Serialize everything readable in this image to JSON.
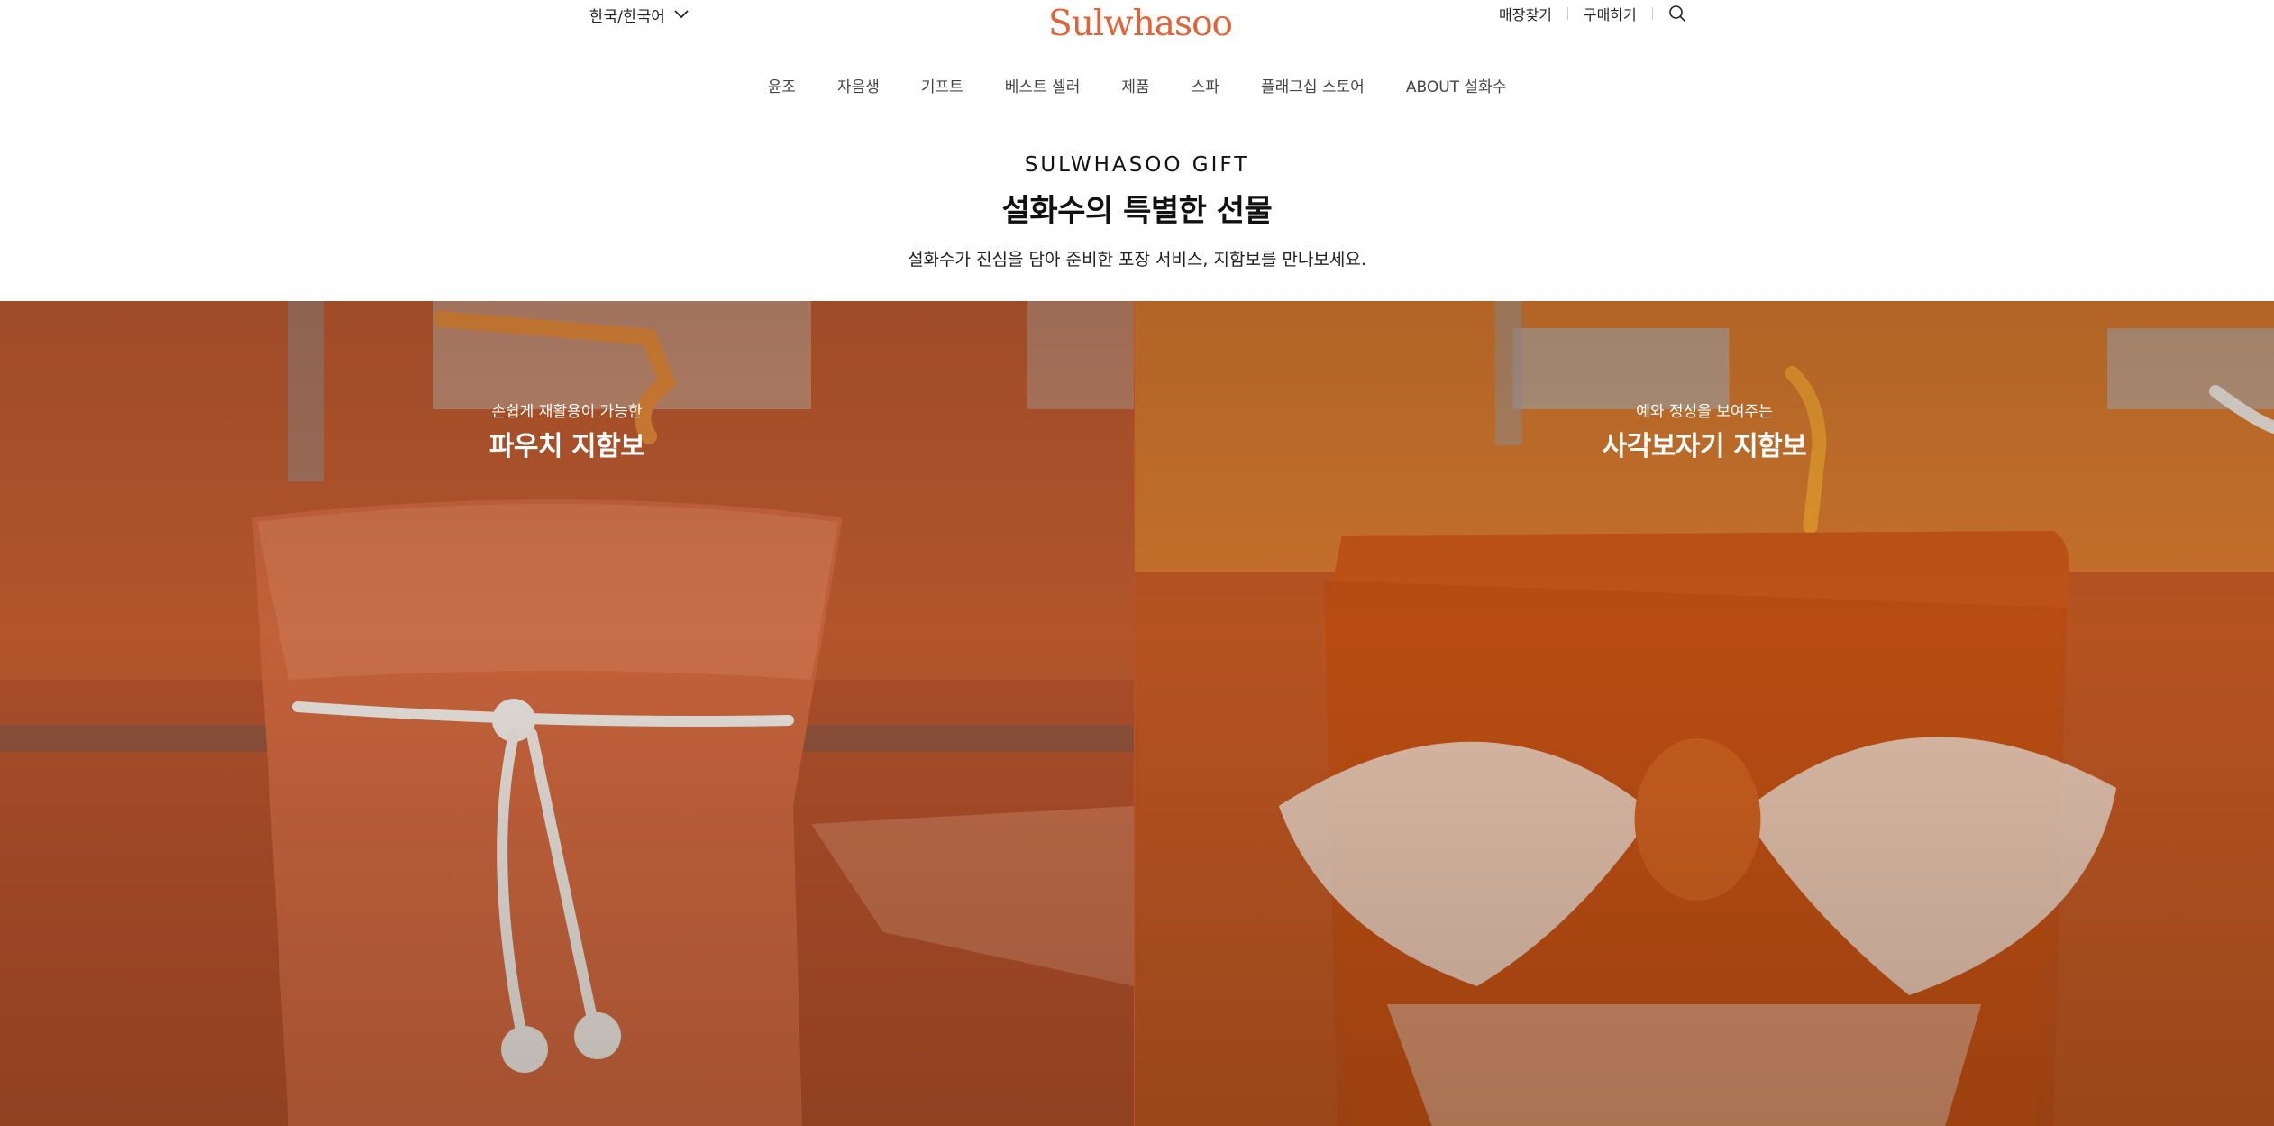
{
  "header": {
    "language": "한국/한국어",
    "logo": "Sulwhasoo",
    "utility_links": [
      "매장찾기",
      "구매하기"
    ]
  },
  "gnb": {
    "items": [
      "윤조",
      "자음생",
      "기프트",
      "베스트 셀러",
      "제품",
      "스파",
      "플래그십 스토어",
      "ABOUT 설화수"
    ]
  },
  "intro": {
    "eyebrow": "SULWHASOO GIFT",
    "title": "설화수의 특별한 선물",
    "description": "설화수가 진심을 담아 준비한 포장 서비스, 지함보를 만나보세요."
  },
  "cards": [
    {
      "subtitle": "손쉽게 재활용이 가능한",
      "title": "파우치 지함보"
    },
    {
      "subtitle": "예와 정성을 보여주는",
      "title": "사각보자기 지함보"
    }
  ],
  "colors": {
    "brand": "#e0643a",
    "card_bg_left": "#b8532c",
    "card_bg_right": "#c55a23"
  },
  "icons": [
    "chevron-down-icon",
    "search-icon"
  ]
}
